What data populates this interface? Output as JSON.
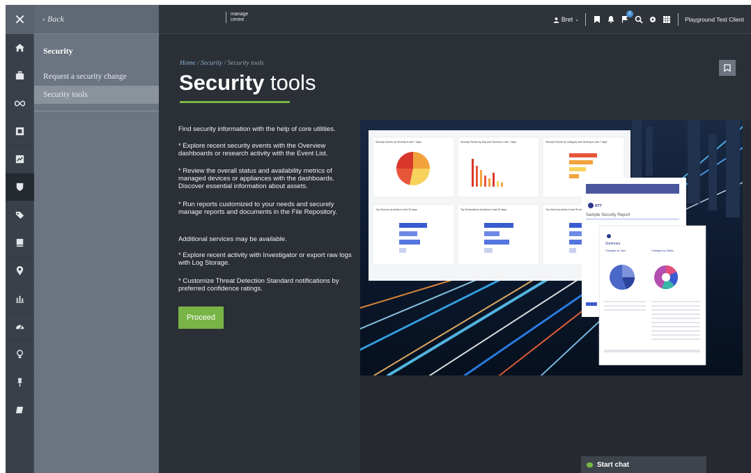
{
  "sidebar": {
    "back_label": "‹ Back",
    "section_title": "Security",
    "items": [
      {
        "label": "Request a security change"
      },
      {
        "label": "Security tools"
      }
    ]
  },
  "icon_rail": [
    "close-icon",
    "home-icon",
    "briefcase-icon",
    "infinity-icon",
    "puzzle-icon",
    "chart-box-icon",
    "shield-icon",
    "tag-icon",
    "book-icon",
    "location-pin-icon",
    "bar-chart-icon",
    "gauge-icon",
    "lightbulb-icon",
    "pin-icon",
    "notebook-icon"
  ],
  "topbar": {
    "logo_line1": "manage",
    "logo_line2": "centre",
    "user_name": "Bret",
    "notification_count": "2",
    "client_name": "Playground Test Client"
  },
  "breadcrumb": {
    "home": "Home",
    "section": "Security",
    "current": "Security tools",
    "sep": "/"
  },
  "page": {
    "title_bold": "Security",
    "title_rest": " tools",
    "intro": "Find security information with the help of core utilities.",
    "bullet1": "* Explore recent security events with the Overview dashboards or research activity with the Event List.",
    "bullet2": "* Review the overall status and availability metrics of managed devices or appliances with the dashboards. Discover essential information about assets.",
    "bullet3": "* Run reports customized to your needs and securely manage reports and documents in the File Repository.",
    "additional": "Additional services may be available.",
    "bullet4": "* Explore recent activity with Investigator or export raw logs with Log Storage.",
    "bullet5": "* Customize Threat Detection Standard notifications by preferred confidence ratings.",
    "proceed_label": "Proceed"
  },
  "hero_image": {
    "card_titles": [
      "Security Events by Severity in last 7 days",
      "Security Events by Day and Severity in last 7 days",
      "Security Events by Category and Severity in last 7 days",
      "Top Sources by Action in last 30 days",
      "Top Destinations by Action in last 30 days",
      "Top Users by Action in last 30 days"
    ],
    "report_title": "Sample Security Report",
    "report_brand": "NTT",
    "summary_label": "Summary",
    "changes_by_type": "Changes by Type",
    "changes_by_status": "Changes by Status"
  },
  "chat": {
    "label": "Start chat"
  },
  "colors": {
    "accent_green": "#78b446",
    "badge_blue": "#4a90d9",
    "bg_dark": "#2b2f36"
  }
}
